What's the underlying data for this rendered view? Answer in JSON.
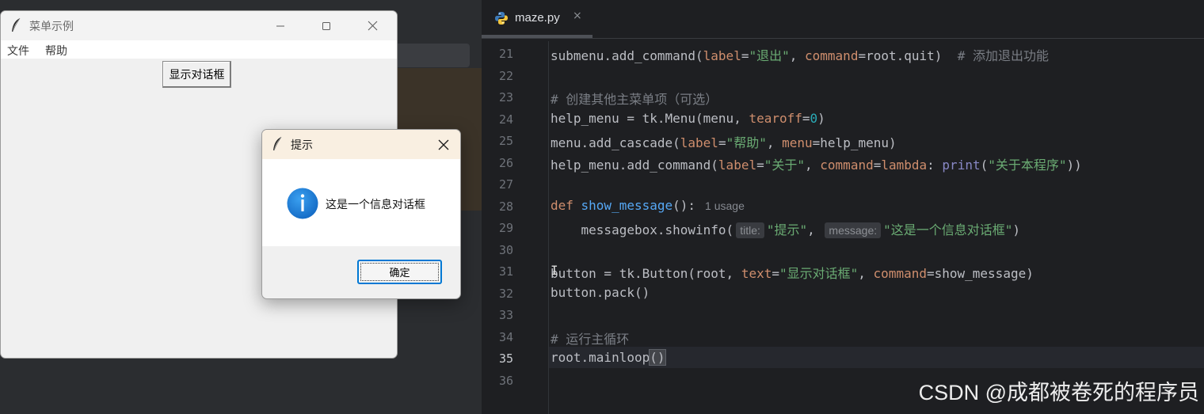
{
  "editor": {
    "tab": {
      "filename": "maze.py",
      "close": "×"
    },
    "lines": [
      {
        "n": "21"
      },
      {
        "n": "22"
      },
      {
        "n": "23"
      },
      {
        "n": "24"
      },
      {
        "n": "25"
      },
      {
        "n": "26"
      },
      {
        "n": "27"
      },
      {
        "n": "28"
      },
      {
        "n": "29"
      },
      {
        "n": "30"
      },
      {
        "n": "31"
      },
      {
        "n": "32"
      },
      {
        "n": "33"
      },
      {
        "n": "34"
      },
      {
        "n": "35"
      },
      {
        "n": "36"
      }
    ],
    "current_line": "35",
    "code": {
      "l21": {
        "a": "submenu.add_command(",
        "p1": "label",
        "eq1": "=",
        "s1": "\"退出\"",
        "c1": ", ",
        "p2": "command",
        "rest": "=root.quit)  ",
        "cm": "# 添加退出功能"
      },
      "l23": {
        "cm": "# 创建其他主菜单项（可选）"
      },
      "l24": {
        "a": "help_menu = tk.Menu(menu, ",
        "p1": "tearoff",
        "eq": "=",
        "num": "0",
        "b": ")"
      },
      "l25": {
        "a": "menu.add_cascade(",
        "p1": "label",
        "eq1": "=",
        "s1": "\"帮助\"",
        "c": ", ",
        "p2": "menu",
        "rest": "=help_menu)"
      },
      "l26": {
        "a": "help_menu.add_command(",
        "p1": "label",
        "eq1": "=",
        "s1": "\"关于\"",
        "c": ", ",
        "p2": "command",
        "eq2": "=",
        "kw": "lambda",
        "colon": ": ",
        "bi": "print",
        "open": "(",
        "s2": "\"关于本程序\"",
        "close": "))"
      },
      "l28": {
        "kw": "def ",
        "fn": "show_message",
        "b": "():",
        "usage": "1 usage"
      },
      "l29": {
        "a": "    messagebox.showinfo(",
        "h1": "title:",
        "s1": "\"提示\"",
        "c": ", ",
        "h2": "message:",
        "s2": "\"这是一个信息对话框\"",
        "b": ")"
      },
      "l31": {
        "a": "button = tk.Button(root, ",
        "p1": "text",
        "eq1": "=",
        "s1": "\"显示对话框\"",
        "c": ", ",
        "p2": "command",
        "rest": "=show_message)"
      },
      "l32": {
        "a": "button.pack()"
      },
      "l34": {
        "cm": "# 运行主循环"
      },
      "l35": {
        "a": "root.mainloop",
        "br": "()"
      }
    }
  },
  "main_window": {
    "title": "菜单示例",
    "menu": [
      "文件",
      "帮助"
    ],
    "button_label": "显示对话框"
  },
  "dialog": {
    "title": "提示",
    "message": "这是一个信息对话框",
    "ok_label": "确定"
  },
  "watermark": "CSDN @成都被卷死的程序员",
  "colors": {
    "editor_bg": "#1e1f22",
    "accent": "#0078d4",
    "info_icon": "#1a7fd9"
  }
}
